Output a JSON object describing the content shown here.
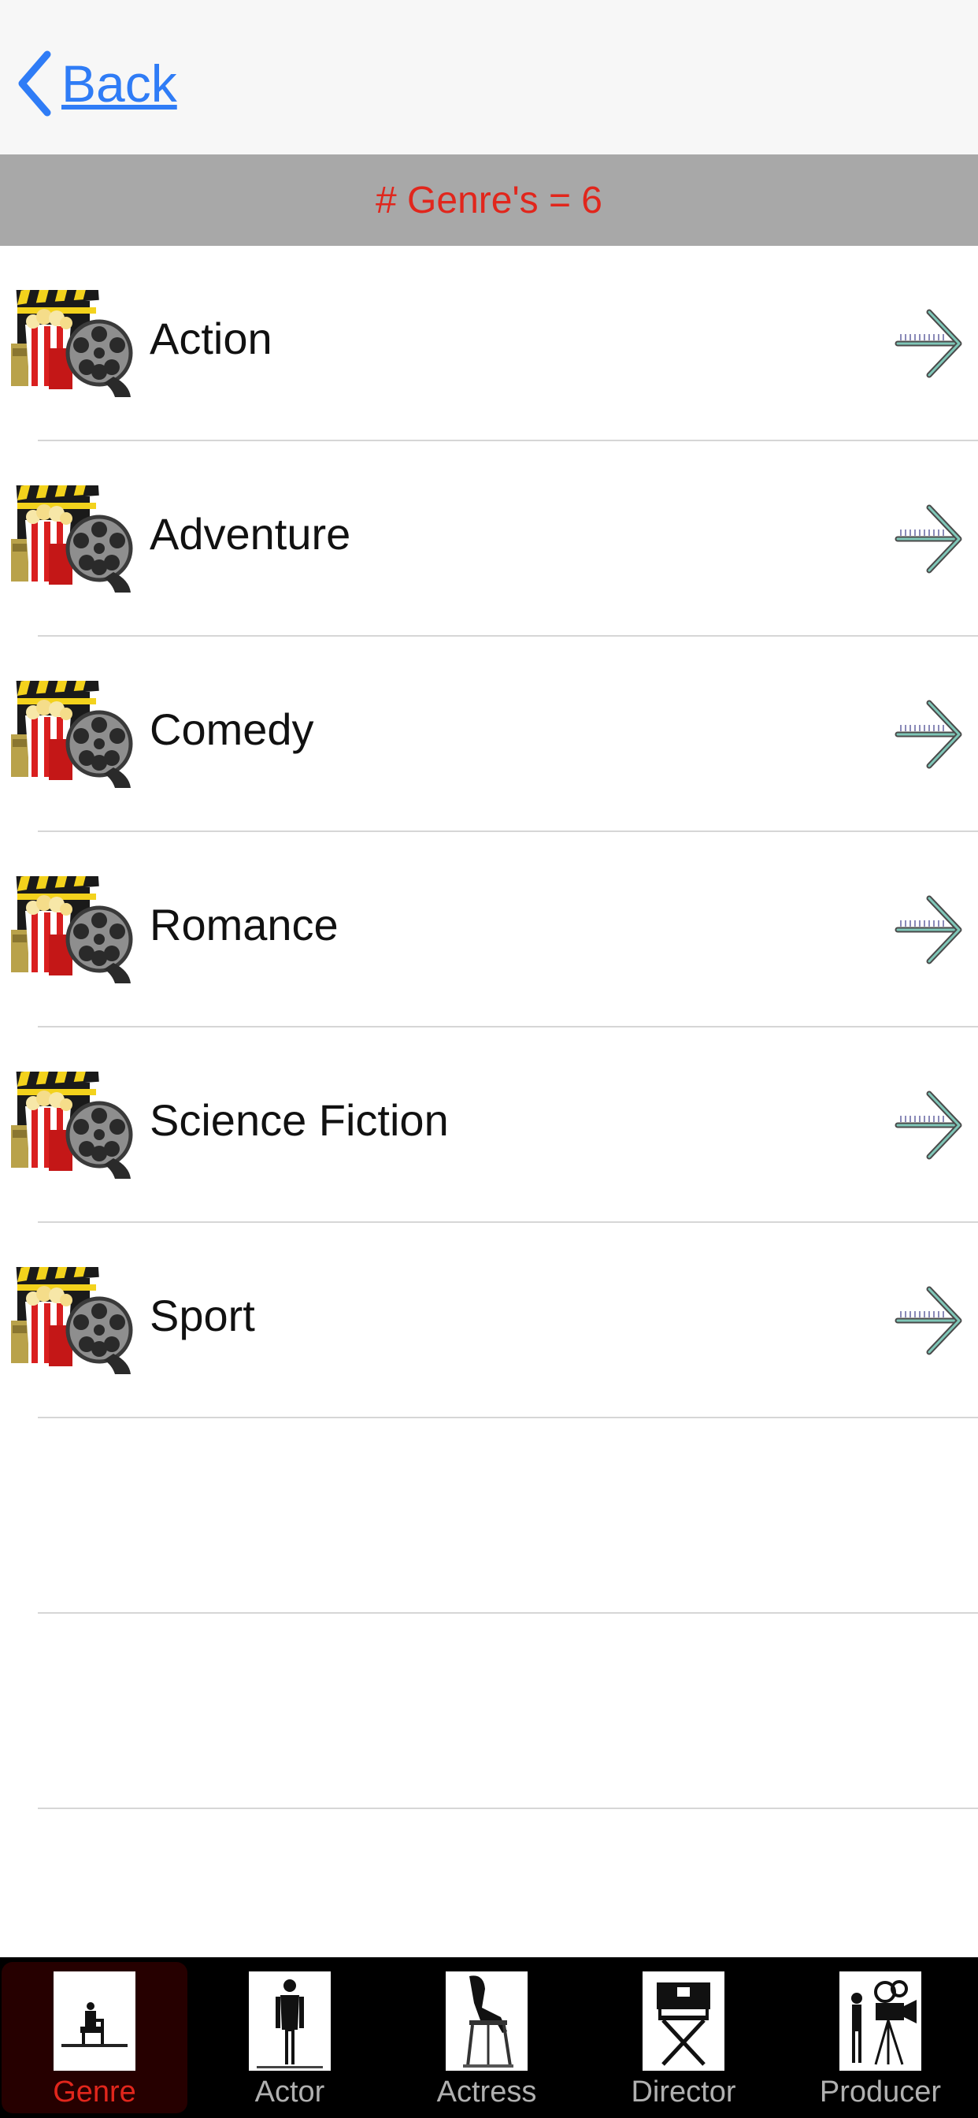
{
  "nav": {
    "back_label": "Back"
  },
  "header": {
    "count_text": "# Genre's = 6"
  },
  "genres": [
    {
      "label": "Action"
    },
    {
      "label": "Adventure"
    },
    {
      "label": "Comedy"
    },
    {
      "label": "Romance"
    },
    {
      "label": "Science Fiction"
    },
    {
      "label": "Sport"
    }
  ],
  "tabs": [
    {
      "label": "Genre",
      "icon": "genre-icon",
      "selected": true
    },
    {
      "label": "Actor",
      "icon": "actor-icon",
      "selected": false
    },
    {
      "label": "Actress",
      "icon": "actress-icon",
      "selected": false
    },
    {
      "label": "Director",
      "icon": "director-icon",
      "selected": false
    },
    {
      "label": "Producer",
      "icon": "producer-icon",
      "selected": false
    }
  ],
  "colors": {
    "accent_blue": "#2f7cf6",
    "count_red": "#e1261c",
    "header_gray": "#a8a8a8",
    "tab_bar_bg": "#000000",
    "arrow_teal": "#7fc7b8"
  }
}
